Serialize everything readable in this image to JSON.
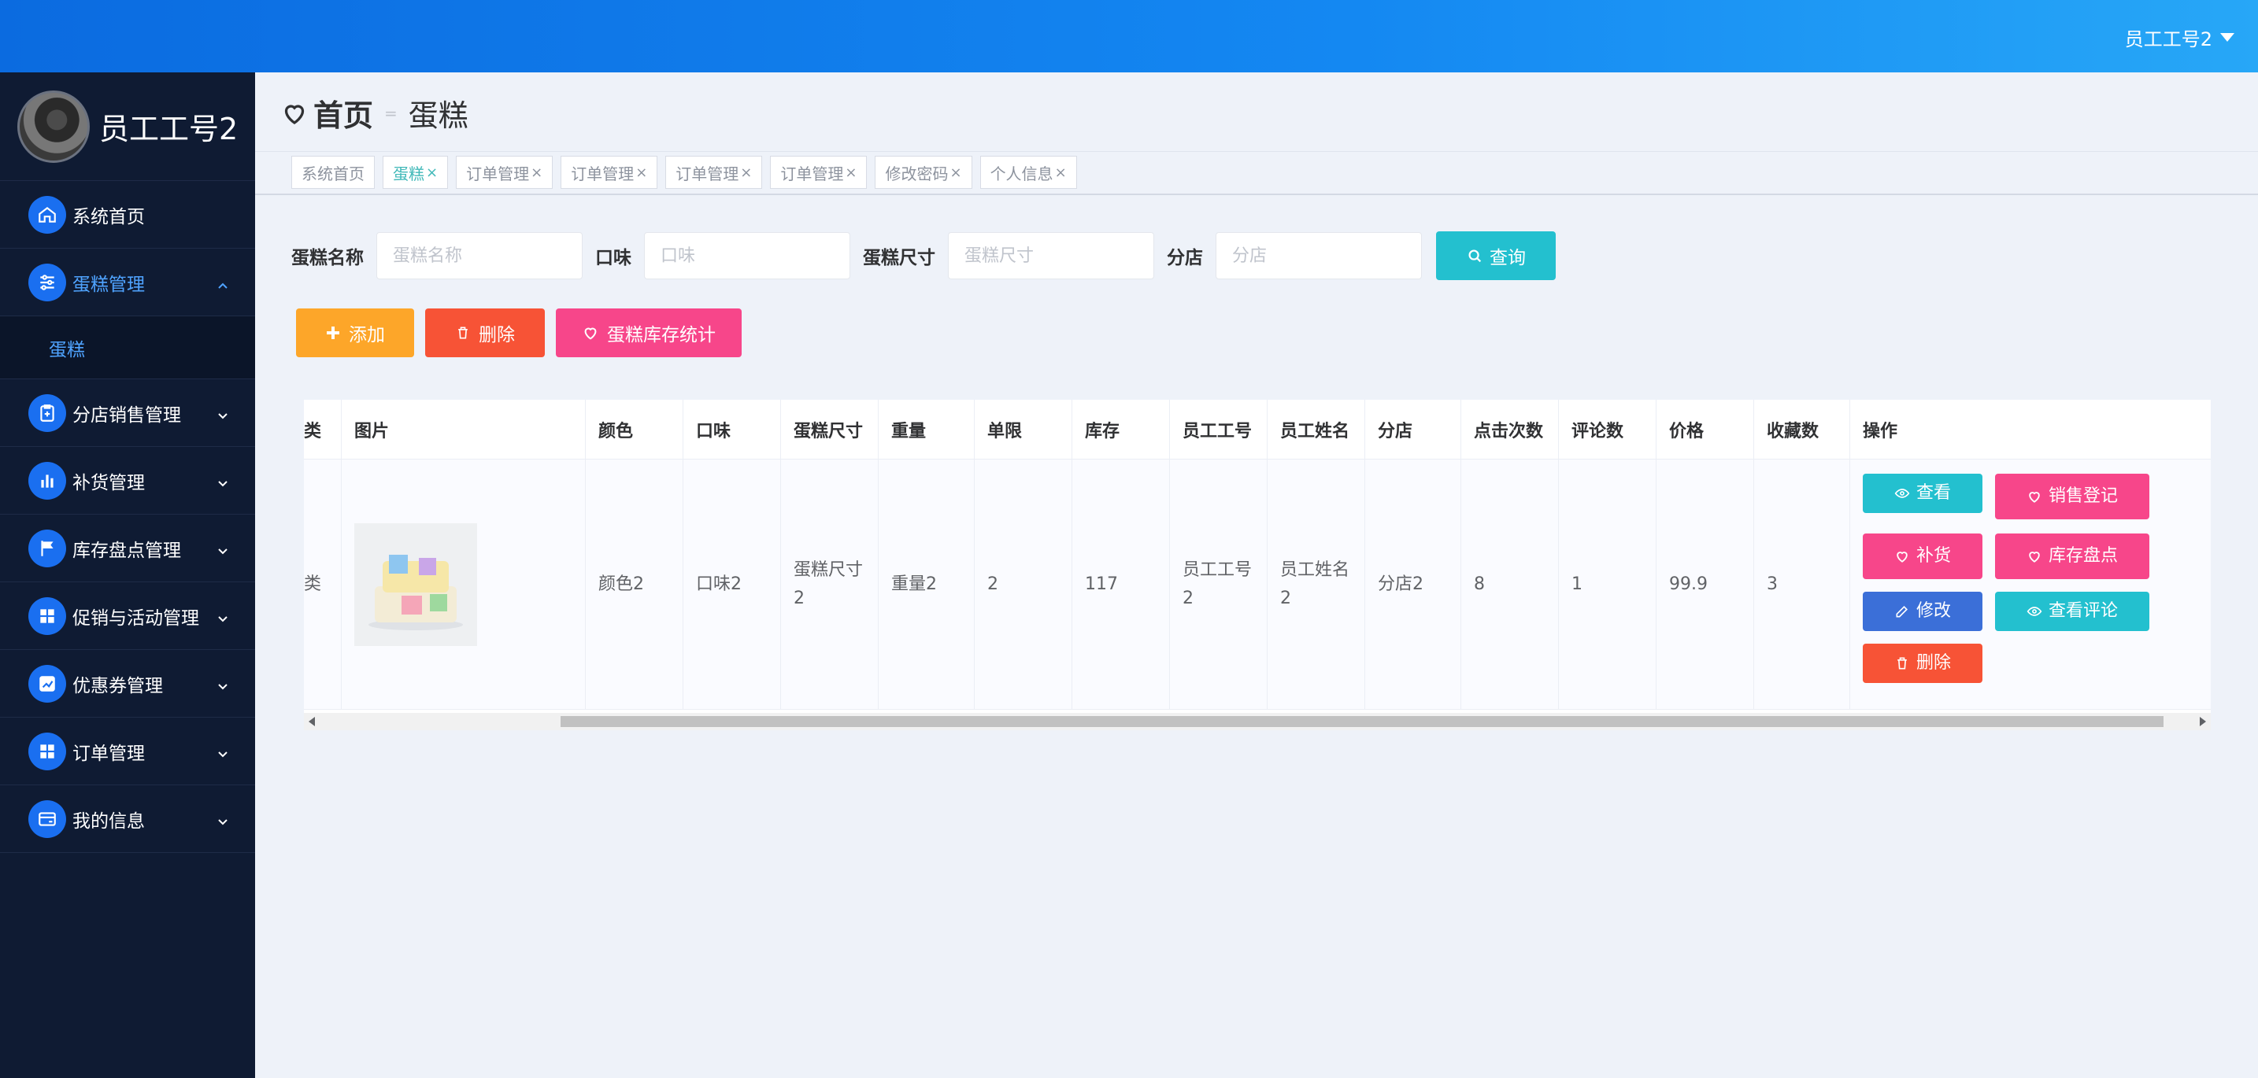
{
  "topbar": {
    "user_label": "员工工号2"
  },
  "sidebar": {
    "profile_name": "员工工号2",
    "items": [
      {
        "label": "系统首页",
        "icon": "home-icon"
      },
      {
        "label": "蛋糕管理",
        "icon": "sliders-icon",
        "expanded": true,
        "sub": [
          "蛋糕"
        ]
      },
      {
        "label": "分店销售管理",
        "icon": "clipboard-icon"
      },
      {
        "label": "补货管理",
        "icon": "bar-chart-icon"
      },
      {
        "label": "库存盘点管理",
        "icon": "flag-icon"
      },
      {
        "label": "促销与活动管理",
        "icon": "grid-icon"
      },
      {
        "label": "优惠券管理",
        "icon": "trend-icon"
      },
      {
        "label": "订单管理",
        "icon": "grid-icon"
      },
      {
        "label": "我的信息",
        "icon": "card-icon"
      }
    ]
  },
  "header": {
    "home": "首页",
    "separator": "=",
    "current": "蛋糕"
  },
  "tabs": [
    {
      "label": "系统首页",
      "closable": false
    },
    {
      "label": "蛋糕",
      "closable": true,
      "active": true
    },
    {
      "label": "订单管理",
      "closable": true
    },
    {
      "label": "订单管理",
      "closable": true
    },
    {
      "label": "订单管理",
      "closable": true
    },
    {
      "label": "订单管理",
      "closable": true
    },
    {
      "label": "修改密码",
      "closable": true
    },
    {
      "label": "个人信息",
      "closable": true
    }
  ],
  "search": {
    "name_label": "蛋糕名称",
    "name_placeholder": "蛋糕名称",
    "flavor_label": "口味",
    "flavor_placeholder": "口味",
    "size_label": "蛋糕尺寸",
    "size_placeholder": "蛋糕尺寸",
    "branch_label": "分店",
    "branch_placeholder": "分店",
    "query_label": "查询"
  },
  "actions": {
    "add": "添加",
    "delete": "删除",
    "stats": "蛋糕库存统计"
  },
  "table": {
    "headers": [
      "类",
      "图片",
      "颜色",
      "口味",
      "蛋糕尺寸",
      "重量",
      "单限",
      "库存",
      "员工工号",
      "员工姓名",
      "分店",
      "点击次数",
      "评论数",
      "价格",
      "收藏数",
      "操作"
    ],
    "rows": [
      [
        "类",
        "",
        "颜色2",
        "口味2",
        "蛋糕尺寸2",
        "重量2",
        "2",
        "117",
        "员工工号2",
        "员工姓名2",
        "分店2",
        "8",
        "1",
        "99.9",
        "3",
        ""
      ]
    ]
  },
  "row_actions": {
    "view": "查看",
    "sale": "销售登记",
    "restock": "补货",
    "inventory": "库存盘点",
    "edit": "修改",
    "comments": "查看评论",
    "delete": "删除"
  },
  "colors": {
    "topbar": "#0b6be0",
    "sidebar": "#0f1b33",
    "accent": "#23c0cf",
    "pink": "#f7468a",
    "red": "#f75336",
    "orange": "#fda629"
  }
}
